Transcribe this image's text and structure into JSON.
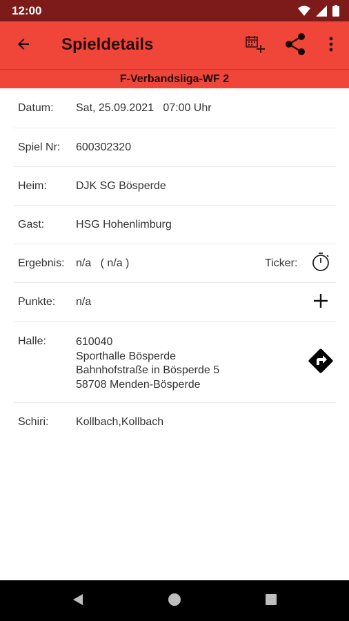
{
  "status_bar": {
    "time": "12:00",
    "icons": [
      "wifi-icon",
      "signal-icon",
      "battery-icon"
    ]
  },
  "app_bar": {
    "title": "Spieldetails",
    "back_icon": "arrow-back-icon",
    "calendar_icon": "calendar-add-icon",
    "share_icon": "share-icon",
    "more_icon": "more-vert-icon"
  },
  "league": "F-Verbandsliga-WF 2",
  "details": {
    "datum_label": "Datum:",
    "datum_value": "Sat, 25.09.2021   07:00 Uhr",
    "spiel_label": "Spiel Nr:",
    "spiel_value": "600302320",
    "heim_label": "Heim:",
    "heim_value": "DJK SG Bösperde",
    "gast_label": "Gast:",
    "gast_value": "HSG Hohenlimburg",
    "ergebnis_label": "Ergebnis:",
    "ergebnis_value": "n/a   ( n/a )",
    "ticker_label": "Ticker:",
    "punkte_label": "Punkte:",
    "punkte_value": "n/a",
    "halle_label": "Halle:",
    "halle_lines": [
      "610040",
      "Sporthalle Bösperde",
      "Bahnhofstraße in Bösperde 5",
      "58708 Menden-Bösperde"
    ],
    "schiri_label": "Schiri:",
    "schiri_value": "Kollbach,Kollbach"
  },
  "colors": {
    "primary": "#f04639",
    "status_bar": "#7d1a1a",
    "nav_bar": "#000000"
  }
}
